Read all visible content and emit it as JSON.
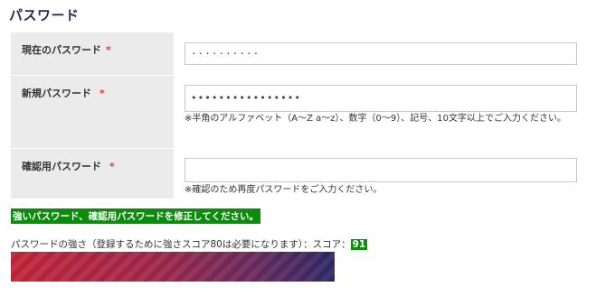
{
  "page": {
    "title": "パスワード"
  },
  "form": {
    "current_password": {
      "label": "現在のパスワード",
      "required_mark": "*",
      "value": "··········"
    },
    "new_password": {
      "label": "新規パスワード",
      "required_mark": "*",
      "value": "••••••••••••••••",
      "hint": "※半角のアルファベット（A〜Z a〜z）、数字（0〜9）、記号、10文字以上でご入力ください。"
    },
    "confirm_password": {
      "label": "確認用パスワード",
      "required_mark": "*",
      "value": "",
      "hint": "※確認のため再度パスワードをご入力ください。"
    }
  },
  "error_message": "強いパスワード、確認用パスワードを修正してください。",
  "strength": {
    "label": "パスワードの強さ（登録するために強さスコア80は必要になります）：スコア：",
    "score": "91",
    "fill_fraction": 1.0,
    "colors": {
      "start": "#c4263a",
      "end": "#2e2a66",
      "badge": "#0b8d0b"
    }
  }
}
